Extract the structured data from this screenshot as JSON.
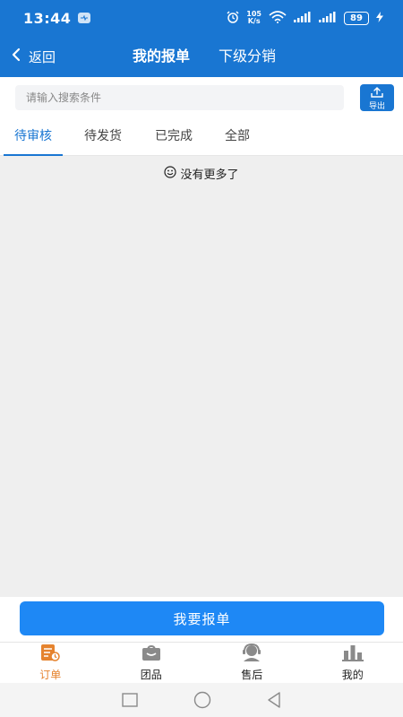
{
  "status": {
    "time": "13:44",
    "net_speed_top": "105",
    "net_speed_bottom": "K/s",
    "battery": "89"
  },
  "nav": {
    "back_label": "返回",
    "title": "我的报单",
    "subtitle": "下级分销"
  },
  "search": {
    "placeholder": "请输入搜索条件",
    "value": "",
    "export_label": "导出"
  },
  "tabs": [
    {
      "label": "待审核",
      "active": true
    },
    {
      "label": "待发货",
      "active": false
    },
    {
      "label": "已完成",
      "active": false
    },
    {
      "label": "全部",
      "active": false
    }
  ],
  "content": {
    "empty_text": "没有更多了"
  },
  "action": {
    "primary_label": "我要报单"
  },
  "tab_bar": [
    {
      "label": "订单",
      "icon": "order-icon",
      "active": true
    },
    {
      "label": "团品",
      "icon": "bag-icon",
      "active": false
    },
    {
      "label": "售后",
      "icon": "service-icon",
      "active": false
    },
    {
      "label": "我的",
      "icon": "stats-icon",
      "active": false
    }
  ],
  "colors": {
    "primary": "#1976d2",
    "button": "#1e88f5",
    "active_tab_bar": "#e5832e"
  }
}
